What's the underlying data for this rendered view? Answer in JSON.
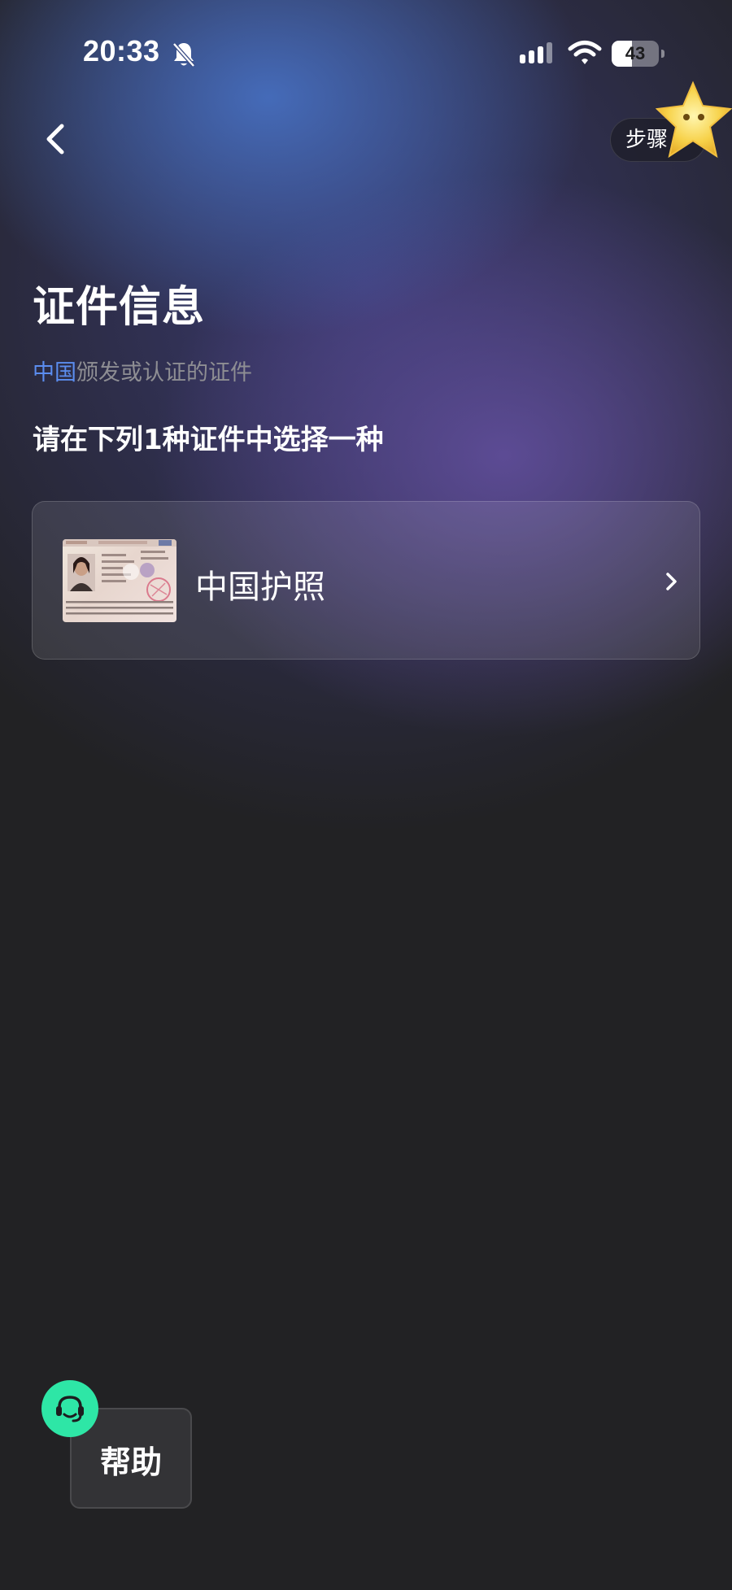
{
  "status_bar": {
    "time": "20:33",
    "battery_level": "43",
    "battery_fraction": 0.43
  },
  "header": {
    "step_label": "步骤 2"
  },
  "page": {
    "title": "证件信息",
    "subtitle_country": "中国",
    "subtitle_rest": "颁发或认证的证件",
    "instruction": "请在下列1种证件中选择一种"
  },
  "documents": [
    {
      "label": "中国护照"
    }
  ],
  "help": {
    "label": "帮助"
  },
  "colors": {
    "accent_link": "#5b8def",
    "help_green": "#2ee6a6",
    "background_dark": "#222224"
  },
  "icons": {
    "back": "chevron-left-icon",
    "document_next": "chevron-right-icon",
    "help": "headset-icon",
    "notifications": "bell-slash-icon",
    "mascot": "star-icon"
  }
}
